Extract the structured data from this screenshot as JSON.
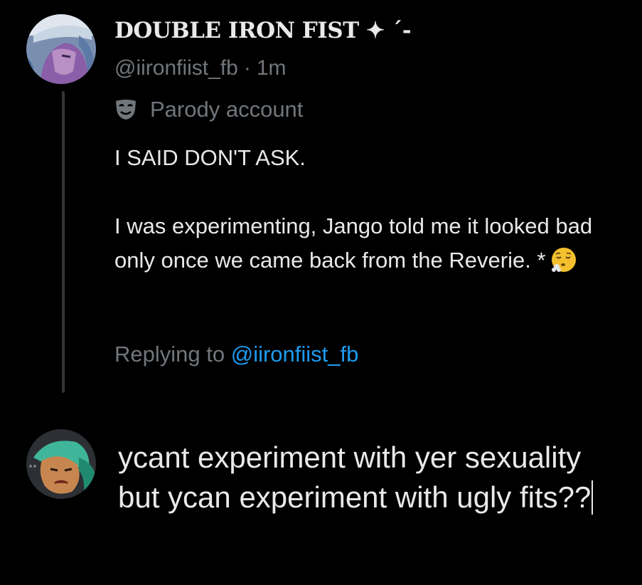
{
  "tweet": {
    "display_name": "DOUBLE IRON FIST ✦ ´-",
    "handle": "@iironfiist_fb",
    "separator": "·",
    "time": "1m",
    "parody_label": "Parody account",
    "parody_icon": "theater-mask-icon",
    "text_line_1": "I SAID DON'T ASK.",
    "text_line_2": "I was experimenting, Jango told me it looked bad only once we came back from the Reverie. *",
    "emoji": "face-exhaling-emoji",
    "replying_prefix": "Replying to",
    "replying_mention": "@iironfiist_fb"
  },
  "reply_composer": {
    "text": "ycant experiment with yer sexuality but ycan experiment with ugly fits??"
  },
  "colors": {
    "background": "#000000",
    "primary_text": "#e7e9ea",
    "secondary_text": "#71767b",
    "link": "#1d9bf0",
    "thread_line": "#333639"
  }
}
